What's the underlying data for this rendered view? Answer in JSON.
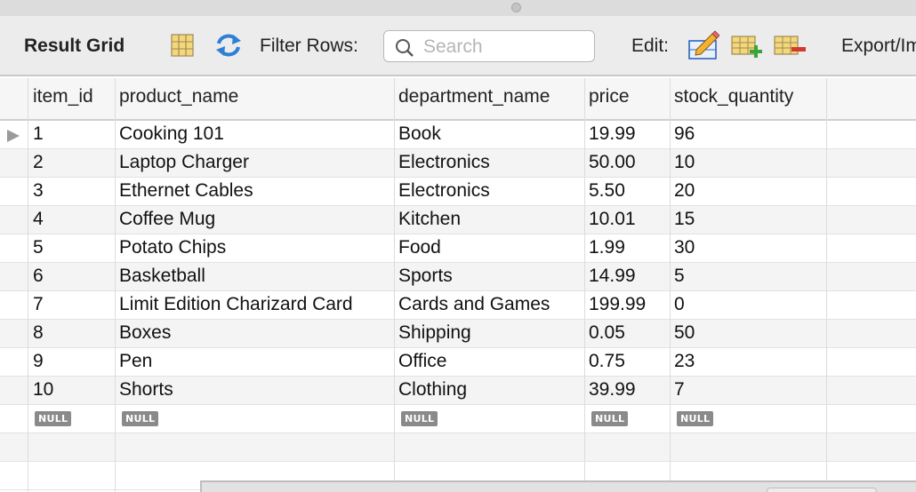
{
  "toolbar": {
    "title": "Result Grid",
    "filter_label": "Filter Rows:",
    "search_placeholder": "Search",
    "edit_label": "Edit:",
    "export_label": "Export/Import:"
  },
  "icons": {
    "grid_toggle": "grid-layout-icon",
    "refresh": "refresh-icon",
    "search": "search-icon",
    "edit_row": "edit-pencil-icon",
    "insert_row": "add-row-icon",
    "delete_row": "delete-row-icon"
  },
  "colors": {
    "refresh_blue": "#2e7fd6",
    "add_green": "#3aa33a",
    "delete_red": "#d23b2b",
    "null_badge": "#8a8a8a"
  },
  "columns": [
    "item_id",
    "product_name",
    "department_name",
    "price",
    "stock_quantity"
  ],
  "rows": [
    [
      "1",
      "Cooking 101",
      "Book",
      "19.99",
      "96"
    ],
    [
      "2",
      "Laptop Charger",
      "Electronics",
      "50.00",
      "10"
    ],
    [
      "3",
      "Ethernet Cables",
      "Electronics",
      "5.50",
      "20"
    ],
    [
      "4",
      "Coffee Mug",
      "Kitchen",
      "10.01",
      "15"
    ],
    [
      "5",
      "Potato Chips",
      "Food",
      "1.99",
      "30"
    ],
    [
      "6",
      "Basketball",
      "Sports",
      "14.99",
      "5"
    ],
    [
      "7",
      "Limit Edition Charizard Card",
      "Cards and Games",
      "199.99",
      "0"
    ],
    [
      "8",
      "Boxes",
      "Shipping",
      "0.05",
      "50"
    ],
    [
      "9",
      "Pen",
      "Office",
      "0.75",
      "23"
    ],
    [
      "10",
      "Shorts",
      "Clothing",
      "39.99",
      "7"
    ]
  ],
  "null_row": [
    "NULL",
    "NULL",
    "NULL",
    "NULL",
    "NULL"
  ]
}
